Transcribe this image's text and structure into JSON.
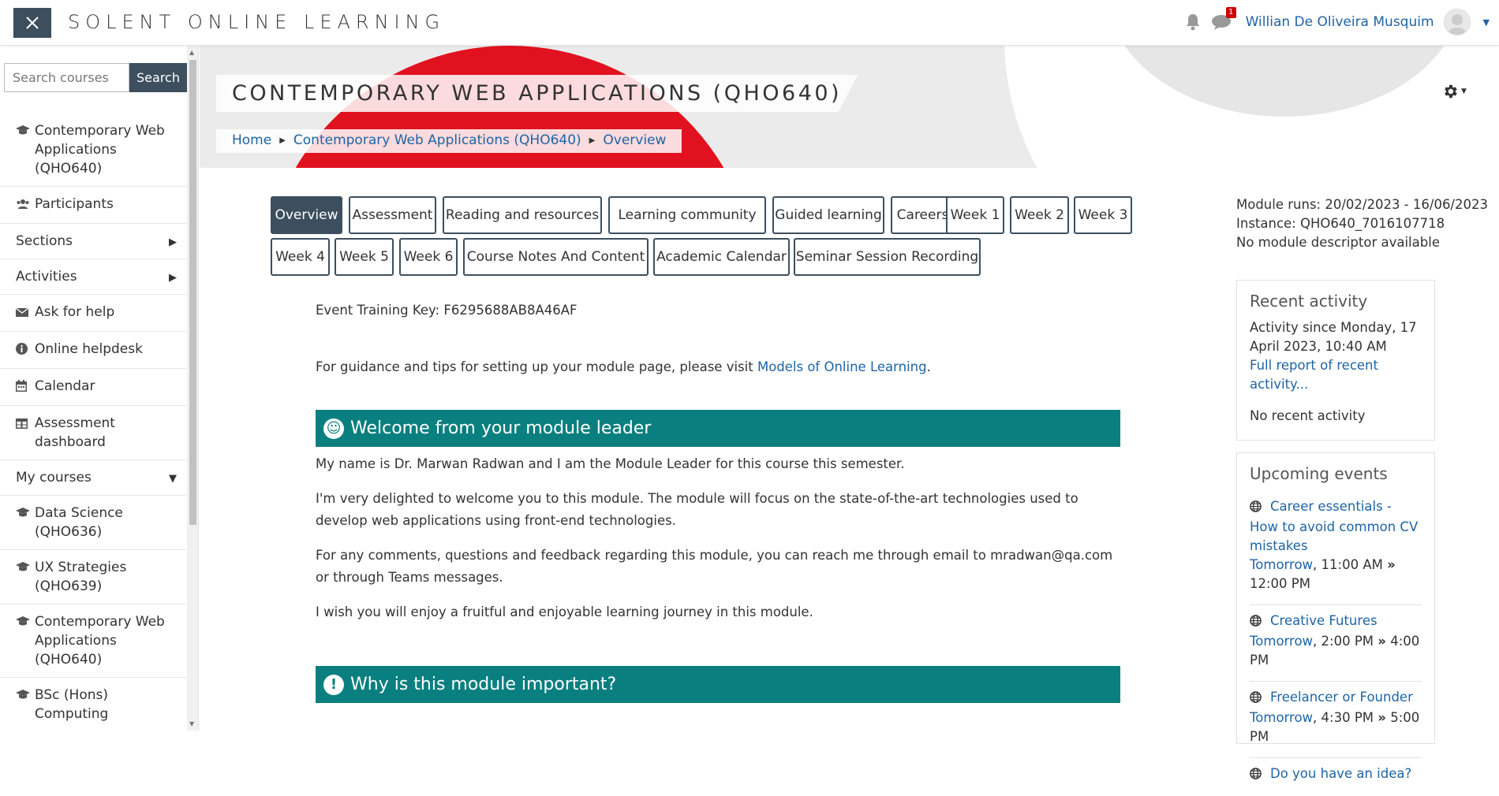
{
  "navbar": {
    "brand": "SOLENT ONLINE LEARNING",
    "messages_badge": "1",
    "username": "Willian De Oliveira Musquim",
    "icons": [
      "close-icon",
      "bell-icon",
      "chat-icon",
      "user-avatar-icon",
      "caret-down-icon"
    ]
  },
  "sidebar": {
    "search_placeholder": "Search courses",
    "search_button": "Search",
    "items": [
      {
        "label": "Contemporary Web Applications (QHO640)",
        "icon": "graduation-cap-icon"
      },
      {
        "label": "Participants",
        "icon": "users-icon"
      },
      {
        "label": "Sections",
        "icon": ""
      },
      {
        "label": "Activities",
        "icon": ""
      },
      {
        "label": "Ask for help",
        "icon": "envelope-icon"
      },
      {
        "label": "Online helpdesk",
        "icon": "info-icon"
      },
      {
        "label": "Calendar",
        "icon": "calendar-icon"
      },
      {
        "label": "Assessment dashboard",
        "icon": "table-icon"
      },
      {
        "label": "My courses",
        "icon": ""
      },
      {
        "label": "Data Science (QHO636)",
        "icon": "graduation-cap-icon"
      },
      {
        "label": "UX Strategies (QHO639)",
        "icon": "graduation-cap-icon"
      },
      {
        "label": "Contemporary Web Applications (QHO640)",
        "icon": "graduation-cap-icon"
      },
      {
        "label": "BSc (Hons) Computing",
        "icon": "graduation-cap-icon"
      }
    ]
  },
  "header": {
    "course_title": "CONTEMPORARY WEB APPLICATIONS (QHO640)",
    "breadcrumb": [
      "Home",
      "Contemporary Web Applications (QHO640)",
      "Overview"
    ]
  },
  "tabs": [
    "Overview",
    "Assessment",
    "Reading and resources",
    "Learning community",
    "Guided learning",
    "Careers",
    "Week 1",
    "Week 2",
    "Week 3",
    "Week 4",
    "Week 5",
    "Week 6",
    "Course Notes And Content",
    "Academic Calendar",
    "Seminar Session Recording"
  ],
  "main": {
    "training_key": "Event Training Key: F6295688AB8A46AF",
    "guidance_prefix": "For guidance and tips for setting up your module page, please visit ",
    "guidance_link": "Models of Online Learning",
    "guidance_suffix": ".",
    "welcome_heading": "Welcome from your module leader",
    "welcome_p1": "My name is Dr. Marwan Radwan and I am the Module Leader for this course this semester.",
    "welcome_p2": "I'm very delighted to welcome you to this module. The module will focus on the state-of-the-art technologies used to develop web applications using front-end technologies.",
    "welcome_p3": "For any comments, questions and feedback regarding this module, you can reach me through email to mradwan@qa.com or through Teams messages.",
    "welcome_p4": "I wish you will enjoy a fruitful and enjoyable learning journey in this module.",
    "why_heading": "Why is this module important?"
  },
  "module_info": {
    "runs": "Module runs: 20/02/2023 - 16/06/2023",
    "instance": "Instance: QHO640_7016107718",
    "descriptor": "No module descriptor available"
  },
  "recent_activity": {
    "title": "Recent activity",
    "since": "Activity since Monday, 17 April 2023, 10:40 AM",
    "full_report": "Full report of recent activity...",
    "none": "No recent activity"
  },
  "upcoming_events": {
    "title": "Upcoming events",
    "events": [
      {
        "name": "Career essentials - How to avoid common CV mistakes",
        "day": "Tomorrow",
        "start": "11:00 AM",
        "end": "12:00 PM"
      },
      {
        "name": "Creative Futures",
        "day": "Tomorrow",
        "start": "2:00 PM",
        "end": "4:00 PM"
      },
      {
        "name": "Freelancer or Founder",
        "day": "Tomorrow",
        "start": "4:30 PM",
        "end": "5:00 PM"
      },
      {
        "name": "Do you have an idea?",
        "day": "",
        "start": "",
        "end": ""
      }
    ]
  },
  "colors": {
    "primary_dark": "#3d4f5f",
    "link": "#1e64a5",
    "section_teal": "#0a7f7f",
    "banner_red": "#e1111f"
  }
}
